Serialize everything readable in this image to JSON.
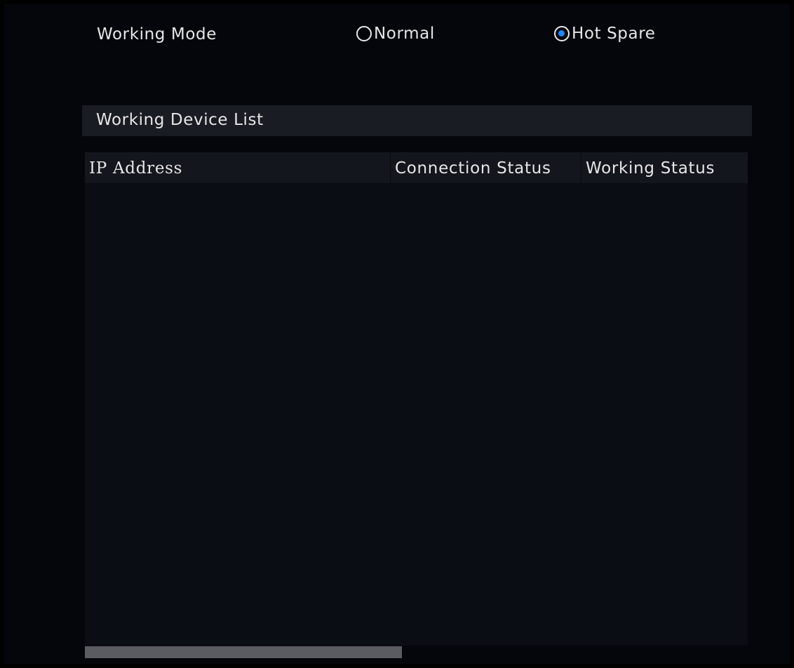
{
  "working_mode": {
    "label": "Working Mode",
    "options": [
      {
        "label": "Normal",
        "selected": false
      },
      {
        "label": "Hot Spare",
        "selected": true
      }
    ]
  },
  "working_device_list": {
    "title": "Working Device List",
    "columns": [
      "IP Address",
      "Connection Status",
      "Working Status"
    ],
    "rows": []
  },
  "colors": {
    "background": "#000000",
    "panel": "#05060c",
    "header_bar": "#1a1c24",
    "radio_accent": "#1e88ff",
    "text": "#e6e6e6"
  }
}
